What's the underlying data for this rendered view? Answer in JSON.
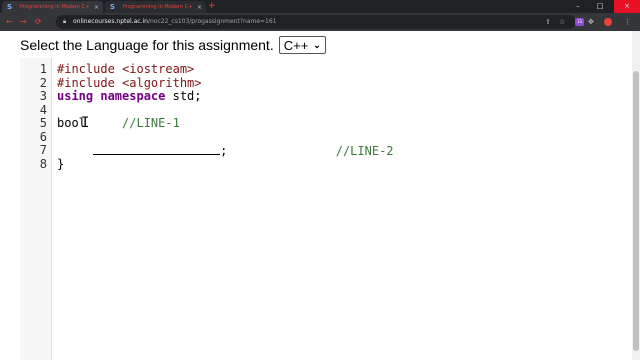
{
  "browser": {
    "tabs": [
      {
        "title": "Programming in Modern C++ - ..."
      },
      {
        "title": "Programming in Modern C++ - ..."
      }
    ],
    "url": {
      "host": "onlinecourses.nptel.ac.in",
      "path": "/noc22_cs103/progassignment?name=161"
    },
    "extension_label": "1S"
  },
  "page": {
    "language_label": "Select the Language for this assignment.",
    "language_selected": "C++"
  },
  "editor": {
    "line_numbers": [
      "1",
      "2",
      "3",
      "4",
      "5",
      "6",
      "7",
      "8"
    ],
    "lines": {
      "l1": "#include <iostream>",
      "l2": "#include <algorithm>",
      "l3_kw": "using namespace",
      "l3_rest": " std;",
      "l5_code": "bool",
      "l5_comment": "//LINE-1",
      "l7_semicolon": ";",
      "l7_comment": "//LINE-2",
      "l8": "}"
    }
  },
  "colors": {
    "preprocessor": "#7f1616",
    "keyword": "#770088",
    "comment": "#3b7a3b",
    "chrome_dark": "#35363a",
    "close_red": "#e81123"
  }
}
